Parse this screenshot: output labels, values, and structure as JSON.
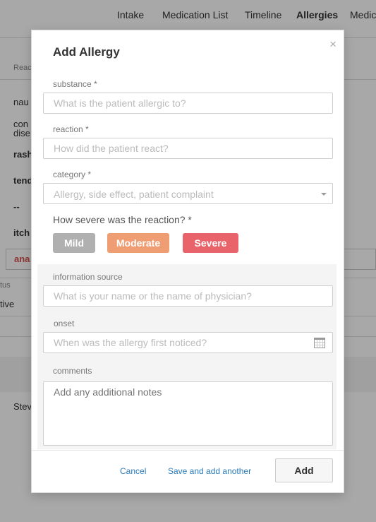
{
  "nav": {
    "tabs": [
      {
        "label": "Intake",
        "active": false
      },
      {
        "label": "Medication List",
        "active": false
      },
      {
        "label": "Timeline",
        "active": false
      },
      {
        "label": "Allergies",
        "active": true
      },
      {
        "label": "Medic",
        "active": false
      }
    ]
  },
  "background": {
    "col_header": "Reac",
    "rows": [
      "nau",
      "con",
      "dise",
      "rash",
      "tend",
      "--",
      "itch"
    ],
    "select_value": "ana",
    "status_header": "tus",
    "status_value": "tive",
    "footer_name": "Stev"
  },
  "modal": {
    "title": "Add Allergy",
    "close_glyph": "×",
    "substance": {
      "label": "substance *",
      "placeholder": "What is the patient allergic to?"
    },
    "reaction": {
      "label": "reaction *",
      "placeholder": "How did the patient react?"
    },
    "category": {
      "label": "category *",
      "placeholder": "Allergy, side effect, patient complaint"
    },
    "severity": {
      "question": "How severe was the reaction? *",
      "options": [
        {
          "label": "Mild",
          "color": "#b0b0b0"
        },
        {
          "label": "Moderate",
          "color": "#ef9e73"
        },
        {
          "label": "Severe",
          "color": "#e8646a"
        }
      ]
    },
    "information_source": {
      "label": "information source",
      "placeholder": "What is your name or the name of physician?"
    },
    "onset": {
      "label": "onset",
      "placeholder": "When was the allergy first noticed?"
    },
    "comments": {
      "label": "comments",
      "placeholder": "Add any additional notes"
    },
    "actions": {
      "cancel": "Cancel",
      "save_another": "Save and add another",
      "add": "Add"
    }
  },
  "colors": {
    "link": "#2a7ab8",
    "overlay": "rgba(0,0,0,0.34)"
  }
}
